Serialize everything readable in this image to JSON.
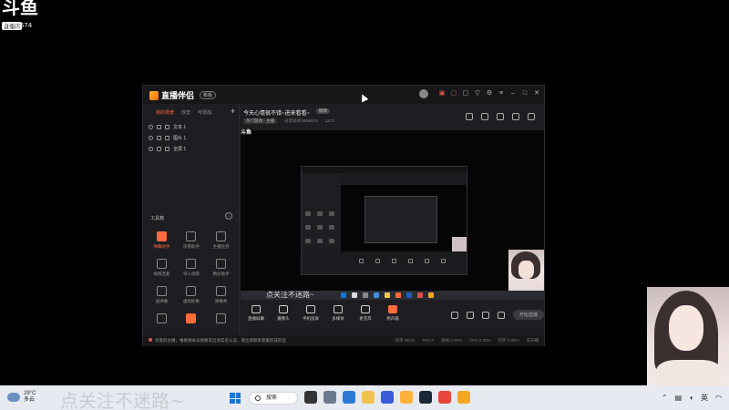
{
  "overlay": {
    "brand_mark": "斗鱼",
    "brand_tag": "直播间",
    "room_id": "8656674"
  },
  "app": {
    "title": "直播伴侣",
    "version_badge": "新版"
  },
  "left_panel": {
    "tabs": [
      "我的场景",
      "双击",
      "可添加"
    ],
    "add": "+",
    "sources": [
      {
        "label": "文本 1"
      },
      {
        "label": "图片 1"
      },
      {
        "label": "全屏 1"
      }
    ],
    "tools_header": "工具箱",
    "tools": [
      {
        "label": "弹幕助手",
        "icon": "gift-icon"
      },
      {
        "label": "房管助手",
        "icon": "user-icon"
      },
      {
        "label": "主播任务",
        "icon": "task-icon"
      },
      {
        "label": "视频连麦",
        "icon": "mic-icon"
      },
      {
        "label": "导入场景",
        "icon": "import-icon"
      },
      {
        "label": "精彩助手",
        "icon": "star-icon"
      },
      {
        "label": "送弹幕",
        "icon": "danmaku-icon"
      },
      {
        "label": "虚拟形象",
        "icon": "avatar-icon"
      },
      {
        "label": "弹幕秀",
        "icon": "show-icon"
      },
      {
        "label": "",
        "icon": "chart-icon"
      },
      {
        "label": "",
        "icon": "more-icon"
      },
      {
        "label": "",
        "icon": "download-icon"
      }
    ]
  },
  "stream": {
    "title": "今天心情很不错~进来看看~",
    "edit": "修改",
    "category": "热门游戏 - 主播",
    "room_label": "分享房间 8656674",
    "viewers": "1173",
    "subtitle": "点关注不迷路~"
  },
  "bottom_tools": [
    {
      "label": "直播屏幕"
    },
    {
      "label": "摄像头"
    },
    {
      "label": "手机投屏"
    },
    {
      "label": "多媒体"
    },
    {
      "label": "麦克风"
    },
    {
      "label": "扬声器"
    }
  ],
  "go_live": "开始直播",
  "notice": {
    "message": "亲爱的主播，根据相关法规要求启动实名认证，请立即联系客服完成验证",
    "stats": [
      "码率 0Kb/s",
      "FPS 0",
      "丢帧 0.00%",
      "CPU 0.00%",
      "内存 0.00%",
      "未开播"
    ]
  },
  "taskbar": {
    "temp": "29°C",
    "weather": "多云",
    "slogan": "点关注不迷路~",
    "search": "搜索",
    "lang": "英"
  },
  "colors": {
    "accent": "#ff6a3d",
    "window_bg": "#1e1e22",
    "taskbar_bg": "#e7ebf1"
  }
}
